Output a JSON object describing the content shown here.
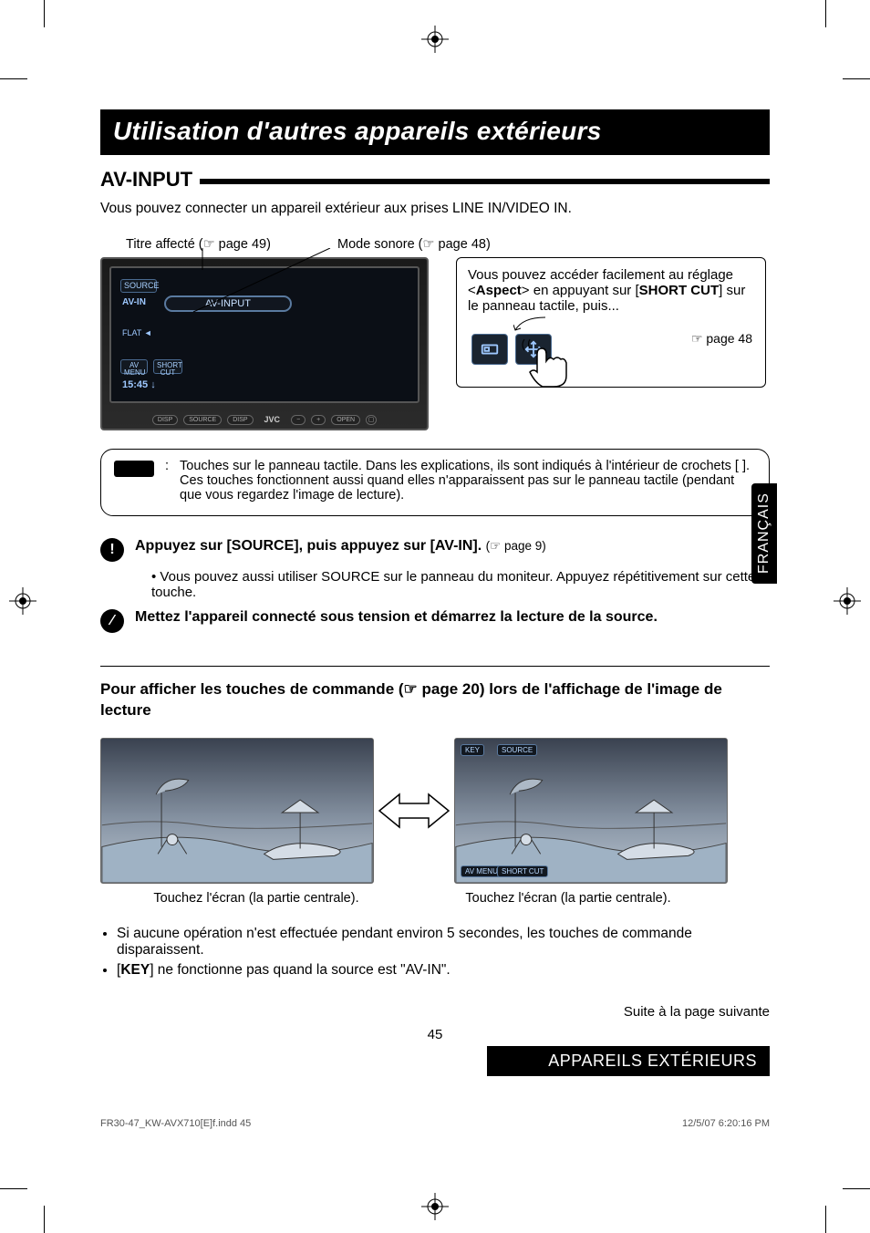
{
  "title_bar": "Utilisation d'autres appareils extérieurs",
  "sub_heading": "AV-INPUT",
  "intro": "Vous pouvez connecter un appareil extérieur aux prises LINE IN/VIDEO IN.",
  "side_tab": "FRANÇAIS",
  "annotations": {
    "title_assigned_prefix": "Titre affecté (",
    "title_assigned_suffix": " page 49)",
    "sound_mode_prefix": "Mode sonore (",
    "sound_mode_suffix": " page 48)"
  },
  "device": {
    "source_btn": "SOURCE",
    "source_label": "AV-IN",
    "pill": "AV-INPUT",
    "flat": "FLAT",
    "time": "15:45",
    "avmenu": "AV MENU",
    "shortcut": "SHORT CUT",
    "bottom": {
      "disp": "DISP",
      "source": "SOURCE",
      "disp2": "DISP",
      "brand": "JVC",
      "minus": "−",
      "plus": "+",
      "open": "OPEN"
    }
  },
  "aspect_note": {
    "line1_a": "Vous pouvez accéder facilement au réglage <",
    "line1_b": "Aspect",
    "line1_c": "> en appuyant sur [",
    "line1_d": "SHORT CUT",
    "line1_e": "] sur le panneau tactile, puis...",
    "ref": "☞ page 48"
  },
  "wide_note": {
    "colon": ":",
    "text": "Touches sur le panneau tactile. Dans les explications, ils sont indiqués à l'intérieur de crochets [        ]. Ces touches fonctionnent aussi quand elles n'apparaissent pas sur le panneau tactile (pendant que vous regardez l'image de lecture)."
  },
  "steps": {
    "s1_bold": "Appuyez sur [SOURCE], puis appuyez sur [AV-IN].",
    "s1_ref_prefix": " (",
    "s1_ref": "☞ page 9",
    "s1_ref_suffix": ")",
    "s1_sub": "Vous pouvez aussi utiliser SOURCE sur le panneau du moniteur. Appuyez répétitivement sur cette touche.",
    "s2_bold": "Mettez l'appareil connecté sous tension et démarrez la lecture de la source."
  },
  "section_title_a": "Pour afficher les touches de commande (",
  "section_title_b": "☞ page 20",
  "section_title_c": ") lors de l'affichage de l'image de lecture",
  "thumb_btns": {
    "key": "KEY",
    "source": "SOURCE",
    "avmenu": "AV MENU",
    "shortcut": "SHORT CUT"
  },
  "caption_left": "Touchez l'écran (la partie centrale).",
  "caption_right": "Touchez l'écran (la partie centrale).",
  "end_bullets": {
    "b1": "Si aucune opération n'est effectuée pendant environ 5 secondes, les touches de commande disparaissent.",
    "b2_a": "[",
    "b2_b": "KEY",
    "b2_c": "] ne fonctionne pas quand la source est \"AV-IN\"."
  },
  "footer_next": "Suite à la page suivante",
  "page_num": "45",
  "footer_black": "APPAREILS EXTÉRIEURS",
  "print": {
    "left": "FR30-47_KW-AVX710[E]f.indd   45",
    "right": "12/5/07   6:20:16 PM"
  },
  "pointer": "☞"
}
